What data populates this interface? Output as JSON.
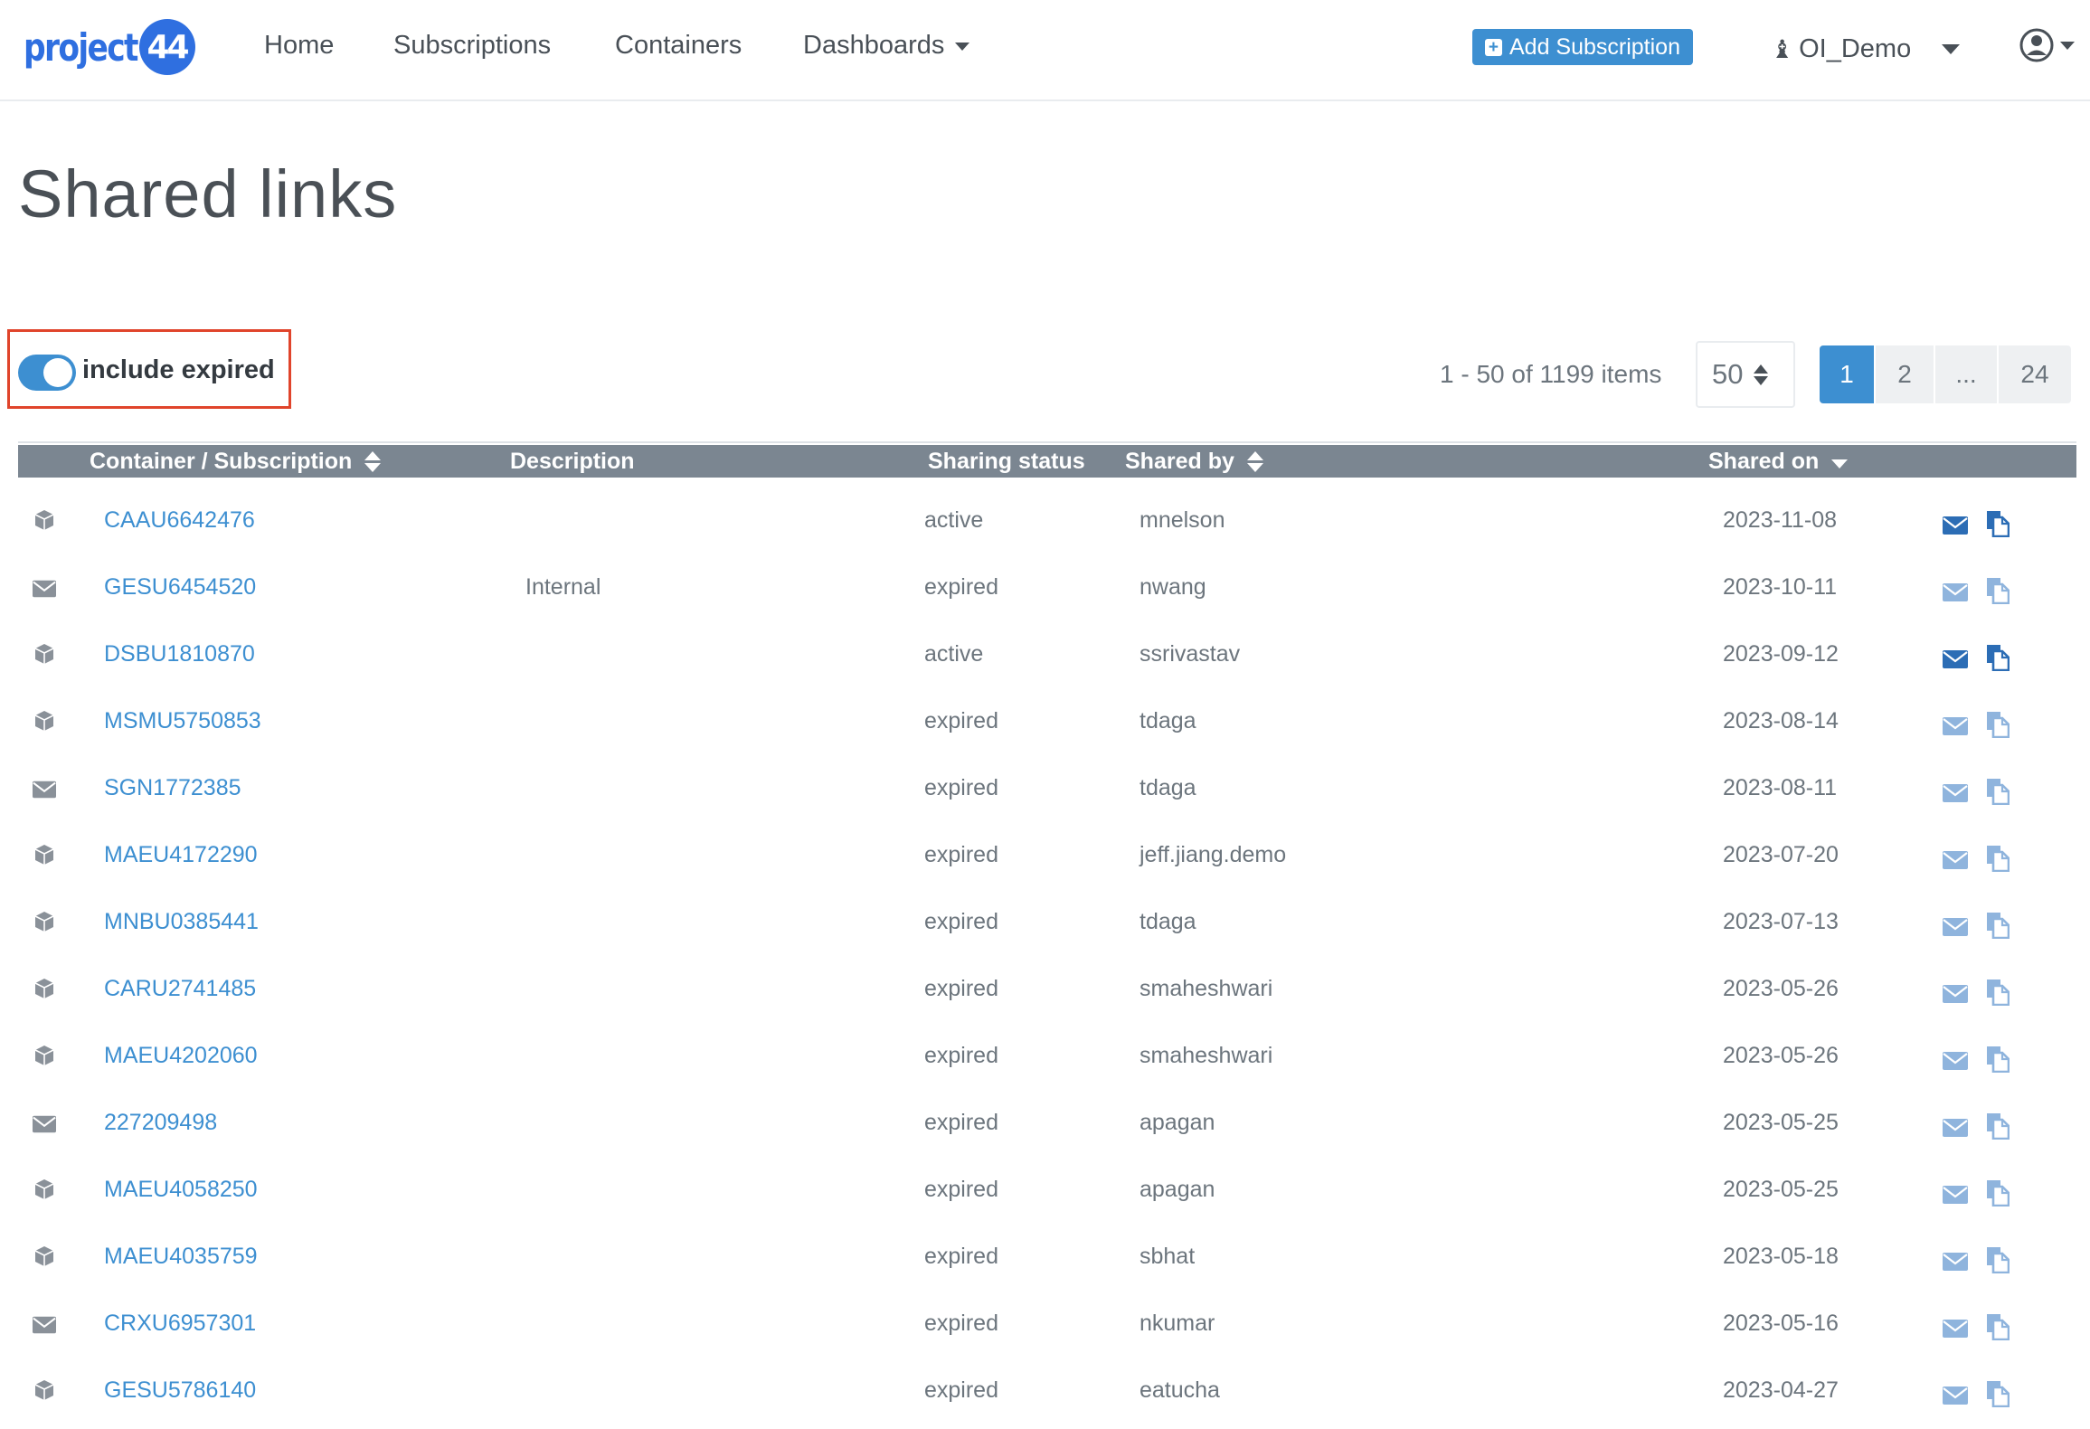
{
  "nav": {
    "logo_text": "project",
    "logo_badge": "44",
    "links": [
      "Home",
      "Subscriptions",
      "Containers",
      "Dashboards"
    ],
    "add_subscription_label": "Add Subscription",
    "org_name": "OI_Demo"
  },
  "page": {
    "title": "Shared links"
  },
  "toolbar": {
    "include_expired_label": "include expired",
    "include_expired_on": true,
    "items_info": "1 - 50 of 1199 items",
    "page_size": "50",
    "pages": [
      "1",
      "2",
      "...",
      "24"
    ],
    "current_page": "1"
  },
  "table": {
    "columns": {
      "container": "Container / Subscription",
      "description": "Description",
      "status": "Sharing status",
      "shared_by": "Shared by",
      "shared_on": "Shared on"
    },
    "rows": [
      {
        "type": "container",
        "id": "CAAU6642476",
        "description": "",
        "status": "active",
        "by": "mnelson",
        "on": "2023-11-08"
      },
      {
        "type": "subscription",
        "id": "GESU6454520",
        "description": "Internal",
        "status": "expired",
        "by": "nwang",
        "on": "2023-10-11"
      },
      {
        "type": "container",
        "id": "DSBU1810870",
        "description": "",
        "status": "active",
        "by": "ssrivastav",
        "on": "2023-09-12"
      },
      {
        "type": "container",
        "id": "MSMU5750853",
        "description": "",
        "status": "expired",
        "by": "tdaga",
        "on": "2023-08-14"
      },
      {
        "type": "subscription",
        "id": "SGN1772385",
        "description": "",
        "status": "expired",
        "by": "tdaga",
        "on": "2023-08-11"
      },
      {
        "type": "container",
        "id": "MAEU4172290",
        "description": "",
        "status": "expired",
        "by": "jeff.jiang.demo",
        "on": "2023-07-20"
      },
      {
        "type": "container",
        "id": "MNBU0385441",
        "description": "",
        "status": "expired",
        "by": "tdaga",
        "on": "2023-07-13"
      },
      {
        "type": "container",
        "id": "CARU2741485",
        "description": "",
        "status": "expired",
        "by": "smaheshwari",
        "on": "2023-05-26"
      },
      {
        "type": "container",
        "id": "MAEU4202060",
        "description": "",
        "status": "expired",
        "by": "smaheshwari",
        "on": "2023-05-26"
      },
      {
        "type": "subscription",
        "id": "227209498",
        "description": "",
        "status": "expired",
        "by": "apagan",
        "on": "2023-05-25"
      },
      {
        "type": "container",
        "id": "MAEU4058250",
        "description": "",
        "status": "expired",
        "by": "apagan",
        "on": "2023-05-25"
      },
      {
        "type": "container",
        "id": "MAEU4035759",
        "description": "",
        "status": "expired",
        "by": "sbhat",
        "on": "2023-05-18"
      },
      {
        "type": "subscription",
        "id": "CRXU6957301",
        "description": "",
        "status": "expired",
        "by": "nkumar",
        "on": "2023-05-16"
      },
      {
        "type": "container",
        "id": "GESU5786140",
        "description": "",
        "status": "expired",
        "by": "eatucha",
        "on": "2023-04-27"
      }
    ]
  },
  "icons": {
    "container_type": "box-icon",
    "subscription_type": "envelope-icon",
    "send_action": "envelope-icon",
    "copy_action": "copy-icon"
  },
  "colors": {
    "accent": "#3d8fd1",
    "header_bg": "#7b8691",
    "icon_active": "#2c6db5",
    "icon_inactive": "#8fb4dd",
    "highlight_border": "#e0442b"
  }
}
